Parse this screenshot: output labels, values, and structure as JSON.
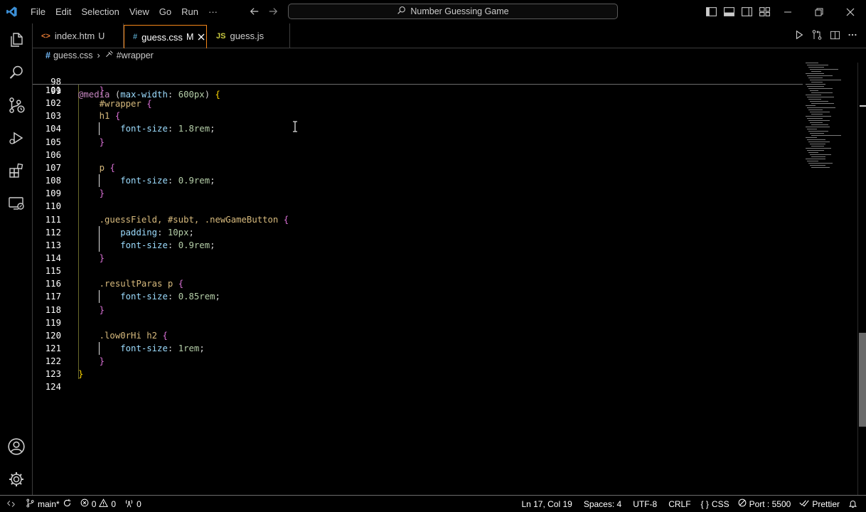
{
  "titlebar": {
    "menu": [
      "File",
      "Edit",
      "Selection",
      "View",
      "Go",
      "Run",
      "···"
    ],
    "search_text": "Number Guessing Game"
  },
  "tabs": [
    {
      "icon": "<>",
      "label": "index.htm",
      "status": "U",
      "active": false
    },
    {
      "icon": "#",
      "label": "guess.css",
      "status": "M",
      "active": true
    },
    {
      "icon": "JS",
      "label": "guess.js",
      "status": "",
      "active": false
    }
  ],
  "breadcrumb": {
    "file": "guess.css",
    "symbol": "#wrapper"
  },
  "sticky": [
    {
      "num": "98",
      "code": "@media (max-width: 600px) {"
    },
    {
      "num": "99",
      "code": "    #wrapper {"
    }
  ],
  "lines": [
    {
      "num": "101",
      "code": "    }"
    },
    {
      "num": "102",
      "code": ""
    },
    {
      "num": "103",
      "code": "    h1 {"
    },
    {
      "num": "104",
      "code": "        font-size: 1.8rem;"
    },
    {
      "num": "105",
      "code": "    }"
    },
    {
      "num": "106",
      "code": ""
    },
    {
      "num": "107",
      "code": "    p {"
    },
    {
      "num": "108",
      "code": "        font-size: 0.9rem;"
    },
    {
      "num": "109",
      "code": "    }"
    },
    {
      "num": "110",
      "code": ""
    },
    {
      "num": "111",
      "code": "    .guessField, #subt, .newGameButton {"
    },
    {
      "num": "112",
      "code": "        padding: 10px;"
    },
    {
      "num": "113",
      "code": "        font-size: 0.9rem;"
    },
    {
      "num": "114",
      "code": "    }"
    },
    {
      "num": "115",
      "code": ""
    },
    {
      "num": "116",
      "code": "    .resultParas p {"
    },
    {
      "num": "117",
      "code": "        font-size: 0.85rem;"
    },
    {
      "num": "118",
      "code": "    }"
    },
    {
      "num": "119",
      "code": ""
    },
    {
      "num": "120",
      "code": "    .low0rHi h2 {"
    },
    {
      "num": "121",
      "code": "        font-size: 1rem;"
    },
    {
      "num": "122",
      "code": "    }"
    },
    {
      "num": "123",
      "code": "}"
    },
    {
      "num": "124",
      "code": ""
    }
  ],
  "statusbar": {
    "branch": "main*",
    "errors": "0",
    "warnings": "0",
    "ports": "0",
    "cursor_pos": "Ln 17, Col 19",
    "spaces": "Spaces: 4",
    "encoding": "UTF-8",
    "eol": "CRLF",
    "language": "CSS",
    "port": "Port : 5500",
    "prettier": "Prettier"
  },
  "colors": {
    "accent_tab_border": "#f38518",
    "background": "#000000",
    "vscode_blue": "#3c8fd6"
  }
}
